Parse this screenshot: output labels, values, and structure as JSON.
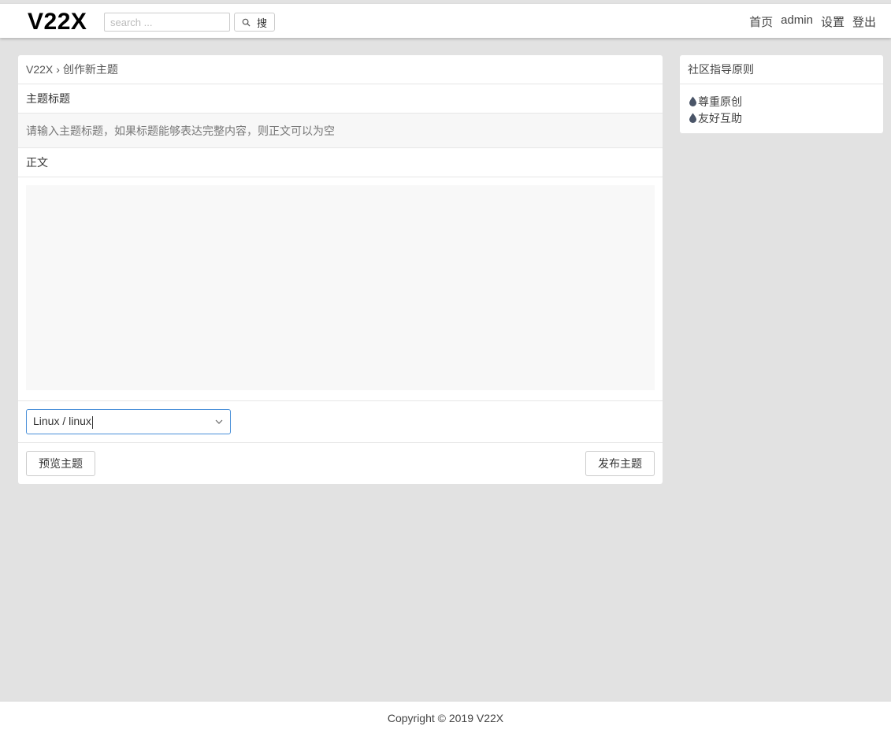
{
  "header": {
    "logo": "V22X",
    "search_placeholder": "search ...",
    "search_button": "搜",
    "nav": [
      "首页",
      "admin",
      "设置",
      "登出"
    ]
  },
  "main": {
    "breadcrumb": {
      "home": "V22X",
      "separator": "›",
      "current": "创作新主题"
    },
    "title_label": "主题标题",
    "title_placeholder": "请输入主题标题，如果标题能够表达完整内容，则正文可以为空",
    "body_label": "正文",
    "body_value": "",
    "node_select": "Linux / linux",
    "preview_button": "预览主题",
    "publish_button": "发布主题"
  },
  "sidebar": {
    "title": "社区指导原则",
    "items": [
      "尊重原创",
      "友好互助"
    ]
  },
  "footer": {
    "copyright": "Copyright © 2019 V22X"
  },
  "colors": {
    "background": "#e2e2e2",
    "select_border": "#4a90d9",
    "drop_icon": "#4a5568"
  }
}
